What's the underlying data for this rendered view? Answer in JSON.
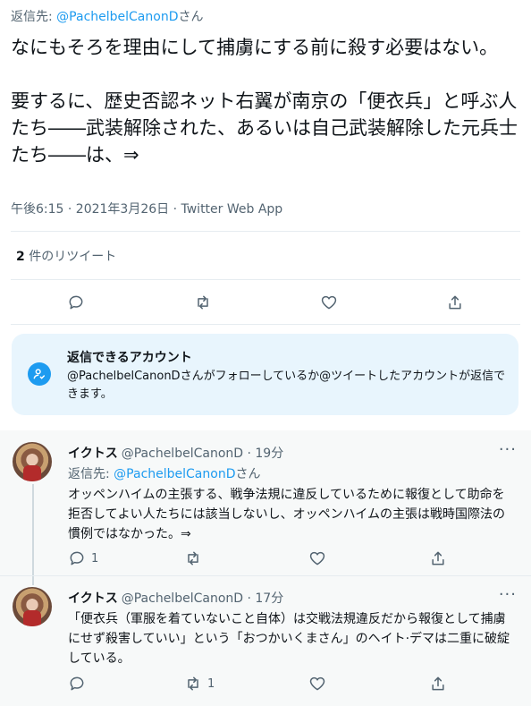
{
  "main_tweet": {
    "reply_prefix": "返信先: ",
    "reply_handle": "@PachelbelCanonD",
    "reply_suffix": "さん",
    "text": "なにもそろを理由にして捕虜にする前に殺す必要はない。\n\n要するに、歴史否認ネット右翼が南京の「便衣兵」と呼ぶ人たち――武装解除された、あるいは自己武装解除した元兵士たち――は、⇒",
    "meta": "午後6:15 · 2021年3月26日 · Twitter Web App",
    "retweet_count": "2",
    "retweet_label": " 件のリツイート"
  },
  "icons": {
    "reply": "reply-icon",
    "retweet": "retweet-icon",
    "like": "heart-icon",
    "share": "share-icon",
    "notice": "user-check-icon",
    "more": "more-icon"
  },
  "notice": {
    "title": "返信できるアカウント",
    "body": "@PachelbelCanonDさんがフォローしているか@ツイートしたアカウントが返信できます。"
  },
  "replies": [
    {
      "name": "イクトス",
      "handle": "@PachelbelCanonD · 19分",
      "reply_prefix": "返信先: ",
      "reply_handle": "@PachelbelCanonD",
      "reply_suffix": "さん",
      "text": "オッペンハイムの主張する、戦争法規に違反しているために報復として助命を拒否してよい人たちには該当しないし、オッペンハイムの主張は戦時国際法の慣例ではなかった。⇒",
      "reply_count": "1",
      "retweet_count": ""
    },
    {
      "name": "イクトス",
      "handle": "@PachelbelCanonD · 17分",
      "text": "「便衣兵（軍服を着ていないこと自体）は交戦法規違反だから報復として捕虜にせず殺害していい」という「おつかいくまさん」のヘイト·デマは二重に破綻している。",
      "reply_count": "",
      "retweet_count": "1"
    }
  ],
  "more_label": "···",
  "colors": {
    "accent": "#1d9bf0",
    "muted": "#536471",
    "notice_bg": "#e8f5fd"
  }
}
